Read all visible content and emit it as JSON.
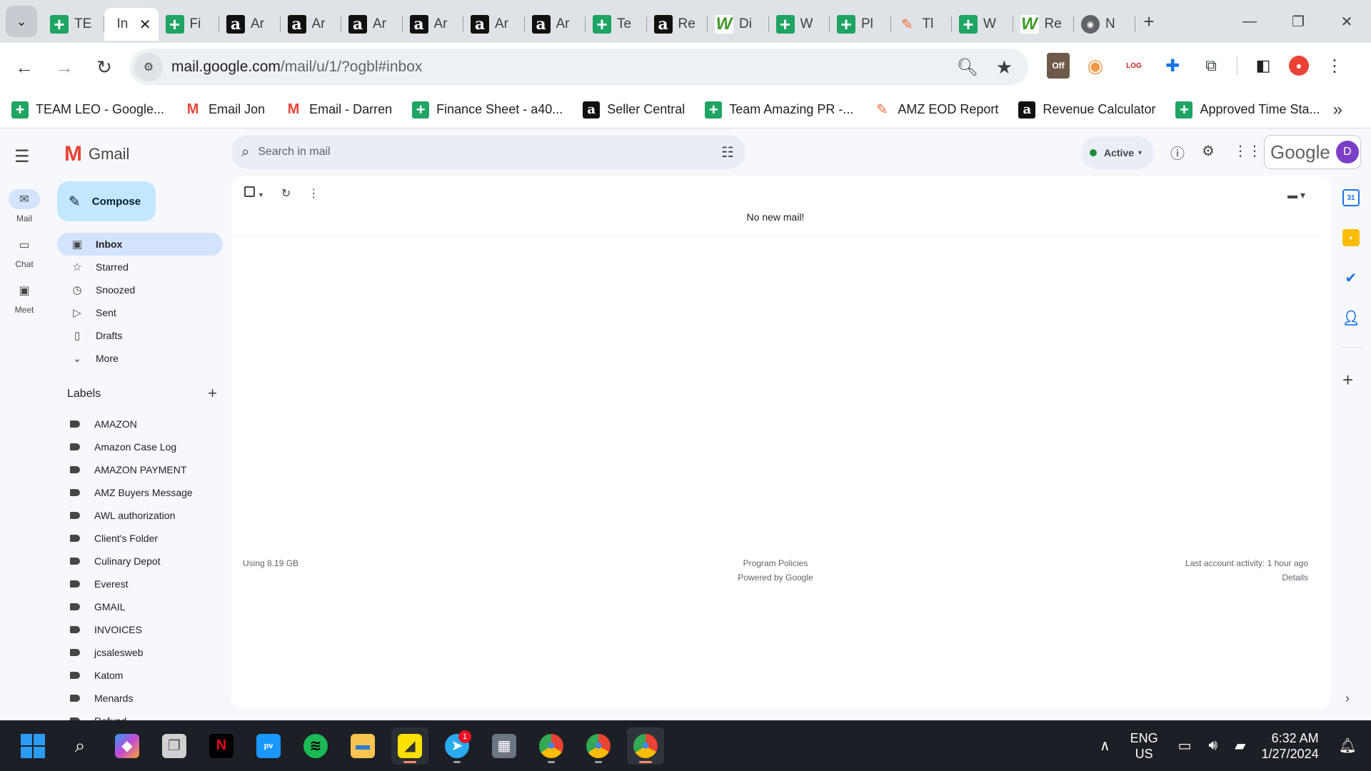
{
  "browser": {
    "tabs": [
      {
        "favicon": "sheets",
        "title": "TE",
        "active": false
      },
      {
        "favicon": "gmail",
        "title": "In",
        "active": true
      },
      {
        "favicon": "sheets",
        "title": "Fi",
        "active": false
      },
      {
        "favicon": "amazon",
        "title": "Ar",
        "active": false
      },
      {
        "favicon": "amazon",
        "title": "Ar",
        "active": false
      },
      {
        "favicon": "amazon",
        "title": "Ar",
        "active": false
      },
      {
        "favicon": "amazon",
        "title": "Ar",
        "active": false
      },
      {
        "favicon": "amazon",
        "title": "Ar",
        "active": false
      },
      {
        "favicon": "amazon",
        "title": "Ar",
        "active": false
      },
      {
        "favicon": "sheets",
        "title": "Te",
        "active": false
      },
      {
        "favicon": "amazon",
        "title": "Re",
        "active": false
      },
      {
        "favicon": "worldl",
        "title": "Di",
        "active": false
      },
      {
        "favicon": "sheets",
        "title": "W",
        "active": false
      },
      {
        "favicon": "sheets",
        "title": "Pl",
        "active": false
      },
      {
        "favicon": "asana",
        "title": "Tl",
        "active": false
      },
      {
        "favicon": "sheets",
        "title": "W",
        "active": false
      },
      {
        "favicon": "worldl",
        "title": "Re",
        "active": false
      },
      {
        "favicon": "chrome",
        "title": "N",
        "active": false
      }
    ],
    "url_host": "mail.google.com",
    "url_path": "/mail/u/1/?ogbl#inbox",
    "bookmarks": [
      {
        "favicon": "sheets",
        "label": "TEAM LEO - Google..."
      },
      {
        "favicon": "gmail",
        "label": "Email Jon"
      },
      {
        "favicon": "gmail",
        "label": "Email - Darren"
      },
      {
        "favicon": "sheets",
        "label": "Finance Sheet - a40..."
      },
      {
        "favicon": "amazon",
        "label": "Seller Central"
      },
      {
        "favicon": "sheets",
        "label": "Team Amazing PR -..."
      },
      {
        "favicon": "asana",
        "label": "AMZ EOD Report"
      },
      {
        "favicon": "amazon",
        "label": "Revenue Calculator"
      },
      {
        "favicon": "sheets",
        "label": "Approved Time Sta..."
      }
    ],
    "extension_off_label": "Off"
  },
  "gmail": {
    "brand": "Gmail",
    "rail": [
      {
        "icon": "mail-icon",
        "label": "Mail"
      },
      {
        "icon": "chat-icon",
        "label": "Chat"
      },
      {
        "icon": "meet-icon",
        "label": "Meet"
      }
    ],
    "compose_label": "Compose",
    "folders": [
      {
        "icon": "inbox-icon",
        "label": "Inbox",
        "active": true
      },
      {
        "icon": "star-icon",
        "label": "Starred",
        "active": false
      },
      {
        "icon": "clock-icon",
        "label": "Snoozed",
        "active": false
      },
      {
        "icon": "send-icon",
        "label": "Sent",
        "active": false
      },
      {
        "icon": "draft-icon",
        "label": "Drafts",
        "active": false
      },
      {
        "icon": "chevron-down-icon",
        "label": "More",
        "active": false
      }
    ],
    "labels_title": "Labels",
    "labels": [
      "AMAZON",
      "Amazon Case Log",
      "AMAZON PAYMENT",
      "AMZ Buyers Message",
      "AWL authorization",
      "Client's Folder",
      "Culinary Depot",
      "Everest",
      "GMAIL",
      "INVOICES",
      "jcsalesweb",
      "Katom",
      "Menards",
      "Refund"
    ],
    "search_placeholder": "Search in mail",
    "status_label": "Active",
    "account_brand": "Google",
    "avatar_initial": "D",
    "empty_message": "No new mail!",
    "footer": {
      "storage": "Using 8.19 GB",
      "policies": "Program Policies",
      "powered": "Powered by Google",
      "activity": "Last account activity: 1 hour ago",
      "details": "Details"
    },
    "side_panel": {
      "calendar_day": "31"
    }
  },
  "taskbar": {
    "telegram_badge": "1",
    "lang_line1": "ENG",
    "lang_line2": "US",
    "time": "6:32 AM",
    "date": "1/27/2024"
  }
}
